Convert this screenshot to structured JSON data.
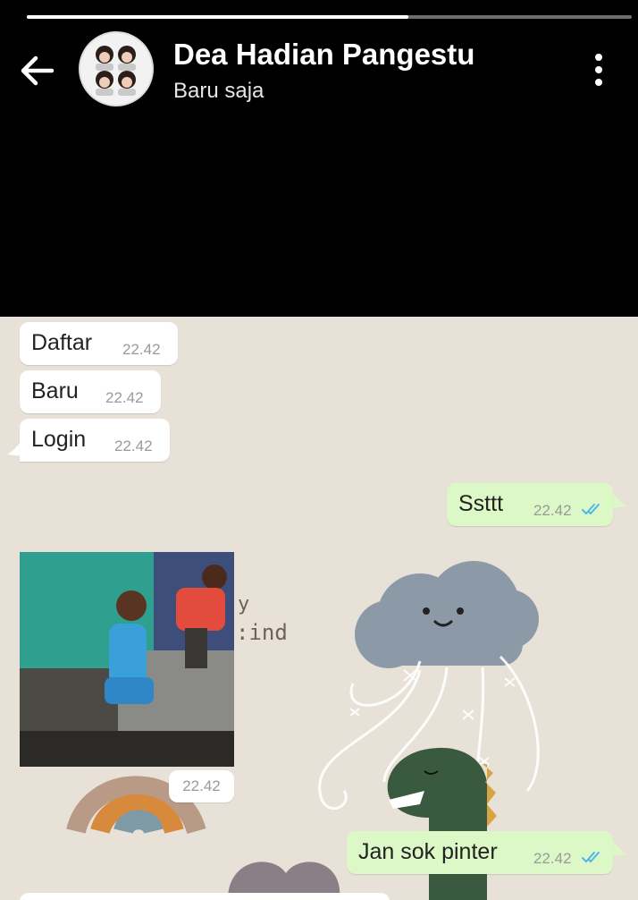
{
  "header": {
    "contact_name": "Dea Hadian Pangestu",
    "status": "Baru saja",
    "progress": 0.63
  },
  "icons": {
    "back": "arrow-left-icon",
    "menu": "more-vertical-icon",
    "read": "double-check-icon"
  },
  "colors": {
    "header_bg": "#000000",
    "chat_bg": "#e8e1d8",
    "incoming_bubble": "#ffffff",
    "outgoing_bubble": "#dcf8c6",
    "read_tick": "#4fb6ec"
  },
  "messages": [
    {
      "direction": "incoming",
      "text": "Daftar",
      "time": "22.42"
    },
    {
      "direction": "incoming",
      "text": "Baru",
      "time": "22.42"
    },
    {
      "direction": "incoming",
      "text": "Login",
      "time": "22.42"
    },
    {
      "direction": "outgoing",
      "text": "Ssttt",
      "time": "22.42",
      "read": true
    },
    {
      "direction": "incoming",
      "type": "image",
      "time": "22.42"
    },
    {
      "direction": "outgoing",
      "text": "Jan sok pinter",
      "time": "22.42",
      "read": true
    }
  ]
}
